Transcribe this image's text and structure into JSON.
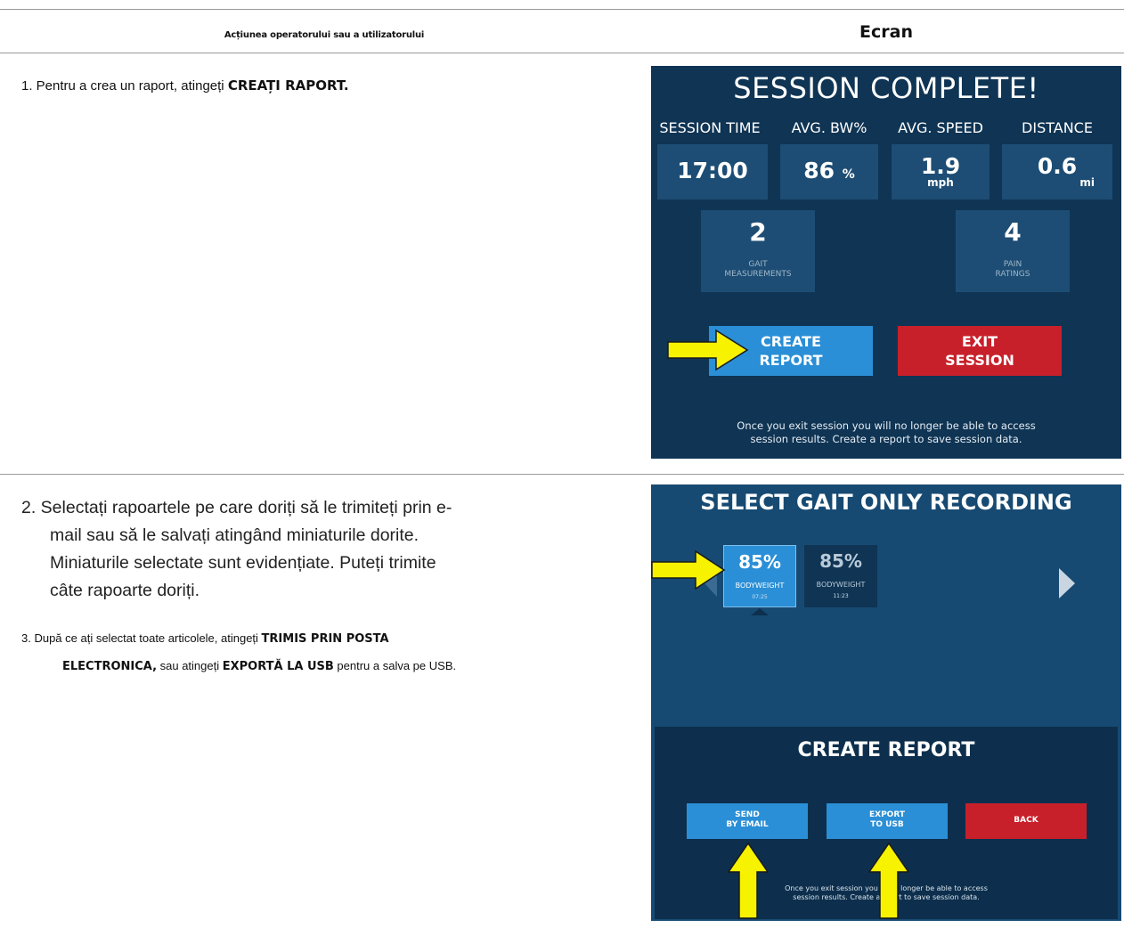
{
  "table": {
    "header_left": "Acțiunea operatorului sau a utilizatorului",
    "header_right": "Ecran"
  },
  "steps": {
    "s1_pre": "1. Pentru a crea un raport, atingeți ",
    "s1_bold": "CREAȚI RAPORT.",
    "s2_line1": "2. Selectați rapoartele pe care doriți să le trimiteți prin e-",
    "s2_line2": "mail sau să le salvați atingând miniaturile dorite.",
    "s2_line3": "Miniaturile selectate sunt evidențiate. Puteți trimite",
    "s2_line4": "câte rapoarte doriți.",
    "s3_pre": "3. După ce ați selectat toate articolele, atingeți ",
    "s3_bold1": "TRIMIS PRIN POSTA",
    "s3_bold2": "ELECTRONICA,",
    "s3_mid": " sau atingeți ",
    "s3_bold3": "EXPORTĂ LA USB",
    "s3_post": " pentru a salva pe USB."
  },
  "screen1": {
    "title": "SESSION COMPLETE!",
    "labels": [
      "SESSION TIME",
      "AVG. BW%",
      "AVG. SPEED",
      "DISTANCE"
    ],
    "session_time": "17:00",
    "bw_value": "86",
    "bw_unit": "%",
    "speed_value": "1.9",
    "speed_unit": "mph",
    "distance_value": "0.6",
    "distance_unit": "mi",
    "gait_count": "2",
    "gait_label1": "GAIT",
    "gait_label2": "MEASUREMENTS",
    "pain_count": "4",
    "pain_label1": "PAIN",
    "pain_label2": "RATINGS",
    "create_line1": "CREATE",
    "create_line2": "REPORT",
    "exit_line1": "EXIT",
    "exit_line2": "SESSION",
    "note_line1": "Once you exit session you will no longer be able to access",
    "note_line2": "session results. Create a report to save session data."
  },
  "screen2": {
    "title": "SELECT GAIT ONLY RECORDING",
    "thumbs": [
      {
        "pct": "85%",
        "label": "BODYWEIGHT",
        "time": "07:25"
      },
      {
        "pct": "85%",
        "label": "BODYWEIGHT",
        "time": "11:23"
      }
    ],
    "panel_title": "CREATE REPORT",
    "email_line1": "SEND",
    "email_line2": "BY EMAIL",
    "usb_line1": "EXPORT",
    "usb_line2": "TO USB",
    "back": "BACK",
    "note_line1": "Once you exit session you",
    "note_line1b": "o longer be able to access",
    "note_line2": "session results. Create a",
    "note_line2b": "rt to save session data."
  },
  "colors": {
    "screen_bg": "#0f3454",
    "tile": "#1d4d74",
    "blue_button": "#2a8fd6",
    "red_button": "#c8202a",
    "arrow": "#f6f200"
  }
}
